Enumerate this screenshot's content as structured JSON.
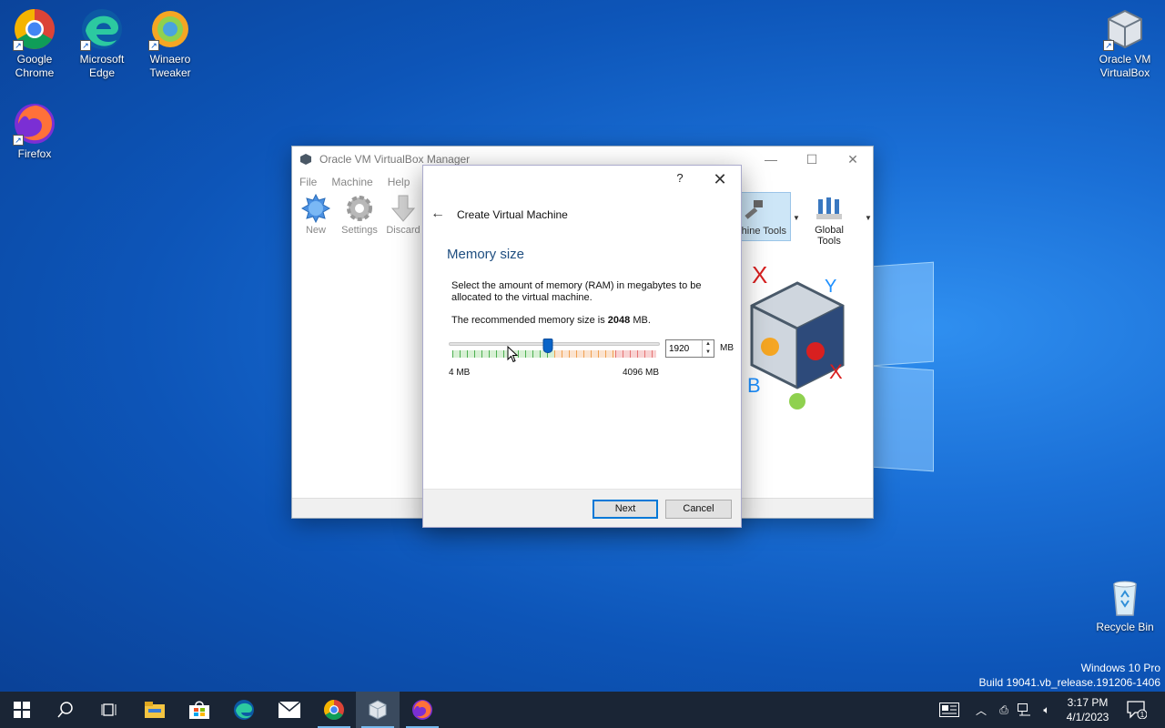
{
  "desktop": {
    "icons": [
      {
        "label": "Google\nChrome",
        "l1": "Google",
        "l2": "Chrome"
      },
      {
        "label": "Microsoft\nEdge",
        "l1": "Microsoft",
        "l2": "Edge"
      },
      {
        "label": "Winaero\nTweaker",
        "l1": "Winaero",
        "l2": "Tweaker"
      },
      {
        "label": "Firefox",
        "l1": "Firefox",
        "l2": ""
      },
      {
        "label": "Oracle VM\nVirtualBox",
        "l1": "Oracle VM",
        "l2": "VirtualBox"
      },
      {
        "label": "Recycle Bin",
        "l1": "Recycle Bin",
        "l2": ""
      }
    ],
    "watermark": {
      "line1": "Windows 10 Pro",
      "line2": "Build 19041.vb_release.191206-1406"
    }
  },
  "manager": {
    "title": "Oracle VM VirtualBox Manager",
    "menu": [
      "File",
      "Machine",
      "Help"
    ],
    "toolbar": [
      {
        "label": "New",
        "icon": "new-icon"
      },
      {
        "label": "Settings",
        "icon": "gear-icon"
      },
      {
        "label": "Discard",
        "icon": "discard-arrow-icon"
      }
    ],
    "machine_tools_label": "hine Tools",
    "global_tools_label": "Global Tools"
  },
  "dialog": {
    "help": "?",
    "title": "Create Virtual Machine",
    "heading": "Memory size",
    "description": "Select the amount of memory (RAM) in megabytes to be allocated to the virtual machine.",
    "recommended_prefix": "The recommended memory size is ",
    "recommended_value": "2048",
    "recommended_suffix": " MB.",
    "memory": {
      "value": "1920",
      "min": 4,
      "max": 4096,
      "current": 1920,
      "unit": "MB",
      "min_label": "4 MB",
      "max_label": "4096 MB",
      "green_end_fraction": 0.5,
      "orange_end_fraction": 0.8
    },
    "next_label": "Next",
    "cancel_label": "Cancel"
  },
  "taskbar": {
    "apps": [
      "start-icon",
      "search-icon",
      "task-view-icon",
      "file-explorer-icon",
      "store-icon",
      "edge-icon",
      "mail-icon",
      "chrome-icon",
      "virtualbox-icon",
      "firefox-icon"
    ],
    "clock_time": "3:17 PM",
    "clock_date": "4/1/2023",
    "notification_count": "1"
  },
  "colors": {
    "accent": "#0078d7",
    "heading": "#1f4e80",
    "thumb": "#0a64c8"
  }
}
